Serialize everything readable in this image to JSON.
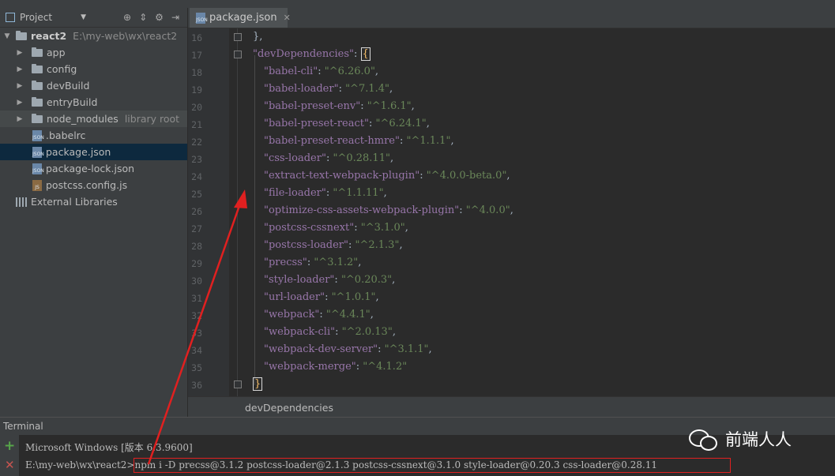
{
  "project_panel": {
    "title": "Project",
    "root": {
      "name": "react2",
      "path": "E:\\my-web\\wx\\react2"
    },
    "folders": [
      {
        "name": "app"
      },
      {
        "name": "config"
      },
      {
        "name": "devBuild"
      },
      {
        "name": "entryBuild"
      },
      {
        "name": "node_modules",
        "note": "library root"
      }
    ],
    "files": [
      {
        "name": ".babelrc",
        "icon": "json-file-icon"
      },
      {
        "name": "package.json",
        "icon": "json-file-icon"
      },
      {
        "name": "package-lock.json",
        "icon": "json-file-icon"
      },
      {
        "name": "postcss.config.js",
        "icon": "js-file-icon"
      }
    ],
    "external": "External Libraries"
  },
  "editor": {
    "tab_label": "package.json",
    "lines": [
      {
        "no": "16",
        "text": "},"
      },
      {
        "no": "17",
        "key": "devDependencies",
        "open": "{"
      },
      {
        "no": "18",
        "key": "babel-cli",
        "val": "^6.26.0"
      },
      {
        "no": "19",
        "key": "babel-loader",
        "val": "^7.1.4"
      },
      {
        "no": "20",
        "key": "babel-preset-env",
        "val": "^1.6.1"
      },
      {
        "no": "21",
        "key": "babel-preset-react",
        "val": "^6.24.1"
      },
      {
        "no": "22",
        "key": "babel-preset-react-hmre",
        "val": "^1.1.1"
      },
      {
        "no": "23",
        "key": "css-loader",
        "val": "^0.28.11"
      },
      {
        "no": "24",
        "key": "extract-text-webpack-plugin",
        "val": "^4.0.0-beta.0"
      },
      {
        "no": "25",
        "key": "file-loader",
        "val": "^1.1.11"
      },
      {
        "no": "26",
        "key": "optimize-css-assets-webpack-plugin",
        "val": "^4.0.0"
      },
      {
        "no": "27",
        "key": "postcss-cssnext",
        "val": "^3.1.0"
      },
      {
        "no": "28",
        "key": "postcss-loader",
        "val": "^2.1.3"
      },
      {
        "no": "29",
        "key": "precss",
        "val": "^3.1.2"
      },
      {
        "no": "30",
        "key": "style-loader",
        "val": "^0.20.3"
      },
      {
        "no": "31",
        "key": "url-loader",
        "val": "^1.0.1"
      },
      {
        "no": "32",
        "key": "webpack",
        "val": "^4.4.1"
      },
      {
        "no": "33",
        "key": "webpack-cli",
        "val": "^2.0.13"
      },
      {
        "no": "34",
        "key": "webpack-dev-server",
        "val": "^3.1.1"
      },
      {
        "no": "35",
        "key": "webpack-merge",
        "val": "^4.1.2",
        "last": true
      },
      {
        "no": "36",
        "text": "}"
      }
    ],
    "breadcrumb": "devDependencies"
  },
  "terminal": {
    "title": "Terminal",
    "line1": "Microsoft Windows [版本 6.3.9600]",
    "prompt": "E:\\my-web\\wx\\react2>",
    "command": "npm i -D precss@3.1.2 postcss-loader@2.1.3 postcss-cssnext@3.1.0 style-loader@0.20.3 css-loader@0.28.11"
  },
  "watermark": "前端人人",
  "colors": {
    "annotation": "#e02020",
    "selection": "#0d293e",
    "key": "#9876aa",
    "string": "#6a8759"
  }
}
